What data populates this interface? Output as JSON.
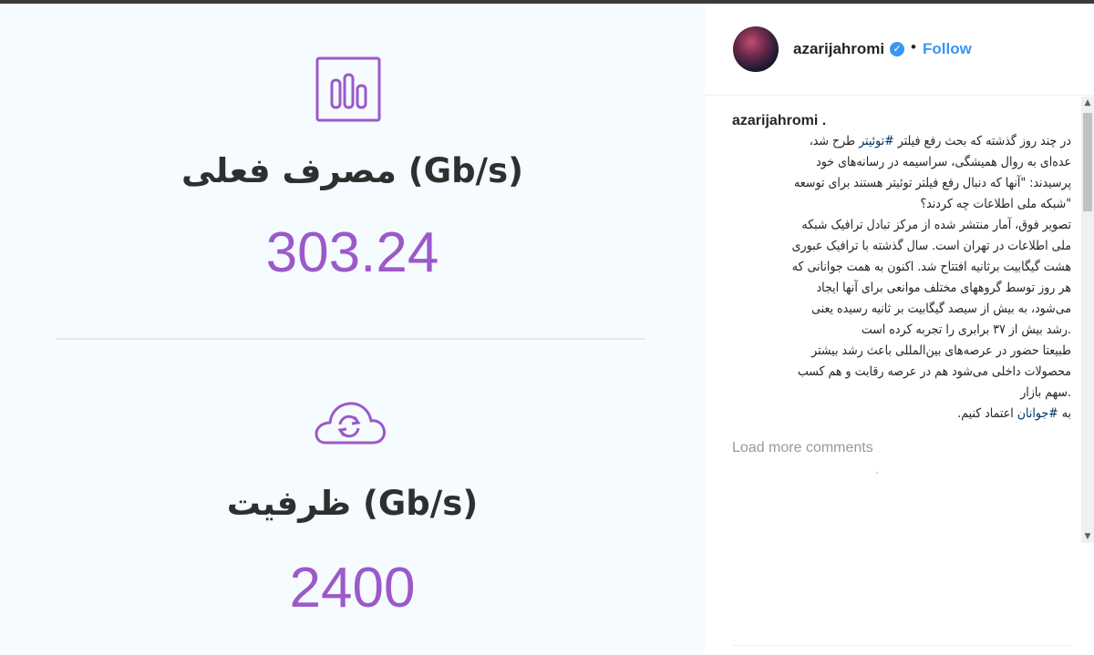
{
  "image": {
    "stats": [
      {
        "icon": "bar-chart-icon",
        "label": "مصرف فعلی (Gb/s)",
        "value": "303.24"
      },
      {
        "icon": "cloud-sync-icon",
        "label": "ظرفیت (Gb/s)",
        "value": "2400"
      }
    ],
    "accent_color": "#9b59c9"
  },
  "header": {
    "username": "azarijahromi",
    "separator": "•",
    "follow_label": "Follow"
  },
  "caption": {
    "username": "azarijahromi .",
    "lines": [
      "در چند روز گذشته که بحث رفع فیلتر",
      "#توئیتر",
      "طرح شد،",
      "عده‌ای به روال همیشگی، سراسیمه در رسانه‌های خود",
      "پرسیدند: \"آنها که دنبال رفع فیلتر توئیتر هستند برای توسعه",
      "\"شبکه ملی اطلاعات چه کردند؟",
      "تصویر فوق، آمار منتشر شده از مرکز تبادل ترافیک شبکه",
      "ملی اطلاعات در تهران است. سال گذشته با ترافیک عبوری",
      "هشت گیگابیت برثانیه افتتاح شد. اکنون به همت جوانانی که",
      "هر روز توسط گروههای مختلف موانعی برای آنها ایجاد",
      "می‌شود، به بیش از سیصد گیگابیت بر ثانیه رسیده یعنی",
      ".رشد بیش از ۳۷ برابری را تجربه کرده است",
      "طبیعتا حضور در عرصه‌های بین‌المللی باعث رشد بیشتر",
      "محصولات داخلی می‌شود هم در عرصه رقابت و هم کسب",
      ".سهم بازار",
      "به",
      "#جوانان",
      "اعتماد کنیم."
    ]
  },
  "comments": {
    "load_more_label": "Load more comments"
  }
}
